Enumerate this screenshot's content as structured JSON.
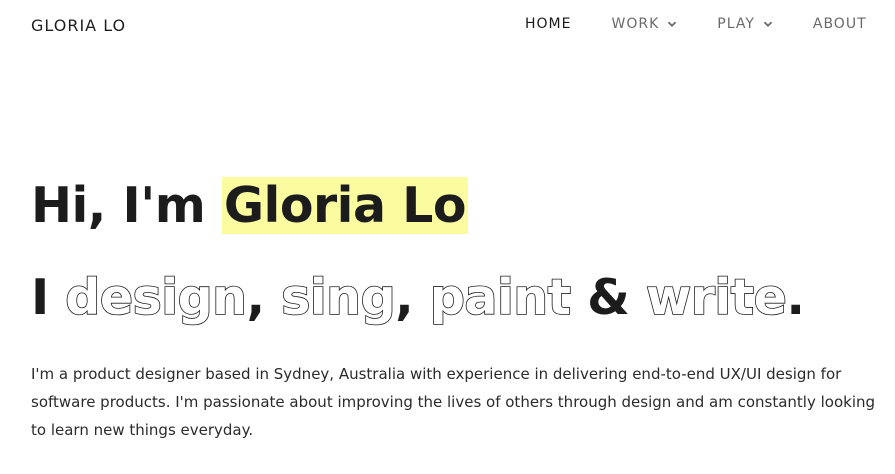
{
  "header": {
    "brand": "GLORIA LO",
    "nav": [
      {
        "label": "HOME",
        "active": true,
        "has_dropdown": false
      },
      {
        "label": "WORK",
        "active": false,
        "has_dropdown": true
      },
      {
        "label": "PLAY",
        "active": false,
        "has_dropdown": true
      },
      {
        "label": "ABOUT",
        "active": false,
        "has_dropdown": false
      }
    ]
  },
  "hero": {
    "greeting_prefix": "Hi, I'm ",
    "name": "Gloria Lo",
    "line2": {
      "lead": "I ",
      "design": "design",
      "sep1": ", ",
      "sing": "sing",
      "sep2": ", ",
      "paint": "paint",
      "amp": " & ",
      "write": "write",
      "end": "."
    }
  },
  "intro": "I'm a product designer based in Sydney, Australia with experience in delivering end-to-end UX/UI design for software products. I'm passionate about improving the lives of others through design and am constantly looking to learn new things everyday.",
  "colors": {
    "highlight": "#fbfb9f",
    "text": "#1c1c1c",
    "nav_inactive": "#6a6a6a"
  },
  "icons": {
    "dropdown": "chevron-down-icon"
  }
}
